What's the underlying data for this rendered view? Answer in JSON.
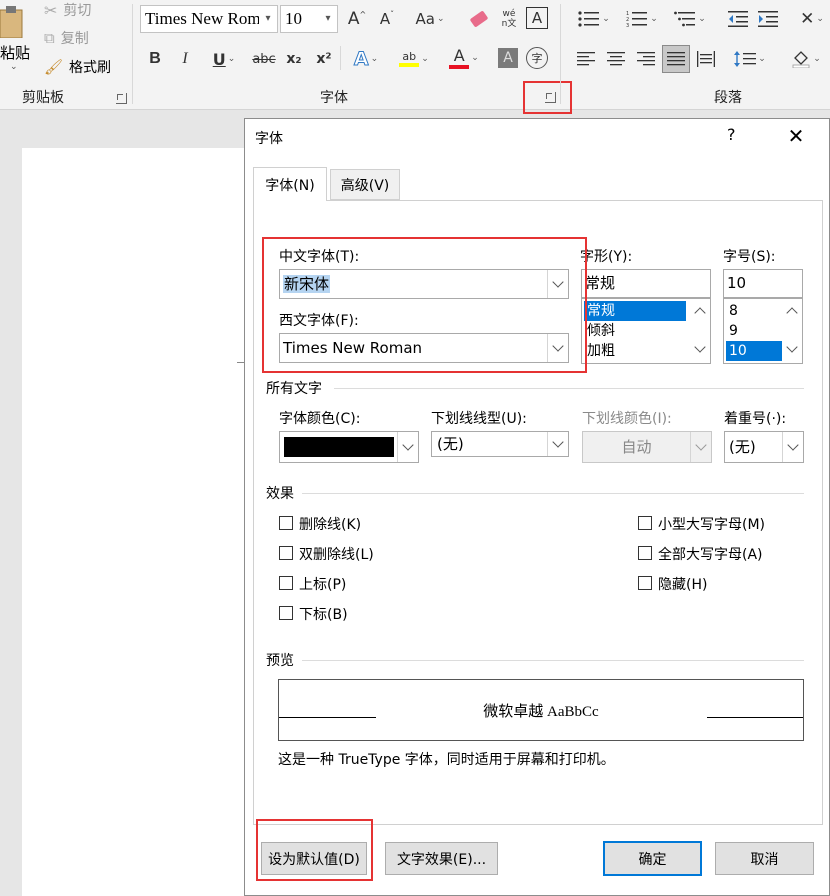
{
  "ribbon": {
    "clipboard": {
      "paste_label": "粘贴",
      "cut_label": "剪切",
      "copy_label": "复制",
      "format_painter_label": "格式刷",
      "group_label": "剪贴板"
    },
    "font": {
      "font_name_value": "Times New Rom",
      "font_size_value": "10",
      "group_label": "字体",
      "bold_label": "B",
      "italic_label": "I",
      "underline_label": "U",
      "strike_label": "abc",
      "sub_label": "x₂",
      "sup_label": "x²",
      "grow_label": "A",
      "shrink_label": "A",
      "case_label": "Aa",
      "phonetic_label": "wén文",
      "border_label": "A",
      "effects_label": "A",
      "highlight_label": "ab",
      "color_label": "A",
      "shading_label": "A",
      "enclose_label": "字"
    },
    "paragraph": {
      "group_label": "段落"
    },
    "colors": {
      "font_color": "#e81123",
      "highlight": "#ffff00",
      "annotation_red": "#e53333"
    }
  },
  "dialog": {
    "title": "字体",
    "help": "?",
    "close": "✕",
    "tabs": [
      {
        "label": "字体(N)"
      },
      {
        "label": "高级(V)"
      }
    ],
    "chinese_font": {
      "label": "中文字体(T):",
      "value": "新宋体"
    },
    "western_font": {
      "label": "西文字体(F):",
      "value": "Times New Roman"
    },
    "style": {
      "label": "字形(Y):",
      "value": "常规",
      "options": [
        "常规",
        "倾斜",
        "加粗"
      ]
    },
    "size": {
      "label": "字号(S):",
      "value": "10",
      "options": [
        "8",
        "9",
        "10"
      ]
    },
    "all_text": {
      "section_label": "所有文字",
      "font_color_label": "字体颜色(C):",
      "font_color_value": "#000000",
      "underline_style_label": "下划线线型(U):",
      "underline_style_value": "(无)",
      "underline_color_label": "下划线颜色(I):",
      "underline_color_value": "自动",
      "emphasis_label": "着重号(·):",
      "emphasis_value": "(无)"
    },
    "effects": {
      "section_label": "效果",
      "left": [
        {
          "label": "删除线(K)",
          "checked": false
        },
        {
          "label": "双删除线(L)",
          "checked": false
        },
        {
          "label": "上标(P)",
          "checked": false
        },
        {
          "label": "下标(B)",
          "checked": false
        }
      ],
      "right": [
        {
          "label": "小型大写字母(M)",
          "checked": false
        },
        {
          "label": "全部大写字母(A)",
          "checked": false
        },
        {
          "label": "隐藏(H)",
          "checked": false
        }
      ]
    },
    "preview": {
      "section_label": "预览",
      "sample_text": "微软卓越  AaBbCc",
      "description": "这是一种 TrueType 字体，同时适用于屏幕和打印机。"
    },
    "buttons": {
      "set_default": "设为默认值(D)",
      "text_effects": "文字效果(E)...",
      "ok": "确定",
      "cancel": "取消"
    }
  }
}
